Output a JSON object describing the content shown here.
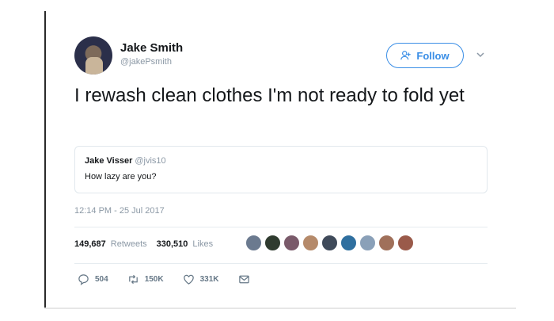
{
  "user": {
    "name": "Jake Smith",
    "handle": "@jakePsmith"
  },
  "follow": {
    "label": "Follow"
  },
  "tweet": {
    "text": "I rewash clean clothes I'm not ready to fold yet",
    "timestamp": "12:14 PM - 25 Jul 2017"
  },
  "quote": {
    "name": "Jake Visser",
    "handle": "@jvis10",
    "text": "How lazy are you?"
  },
  "stats": {
    "retweets_count": "149,687",
    "retweets_label": "Retweets",
    "likes_count": "330,510",
    "likes_label": "Likes"
  },
  "liker_colors": [
    "#6b7a8f",
    "#2f3b2f",
    "#7a5a6a",
    "#b58a6a",
    "#3f4a5a",
    "#2f6f9f",
    "#8aa0b8",
    "#a0705a",
    "#9a5a4a"
  ],
  "actions": {
    "reply_count": "504",
    "retweet_count": "150K",
    "like_count": "331K"
  },
  "colors": {
    "accent": "#3a8ee6",
    "muted": "#8b98a5"
  }
}
